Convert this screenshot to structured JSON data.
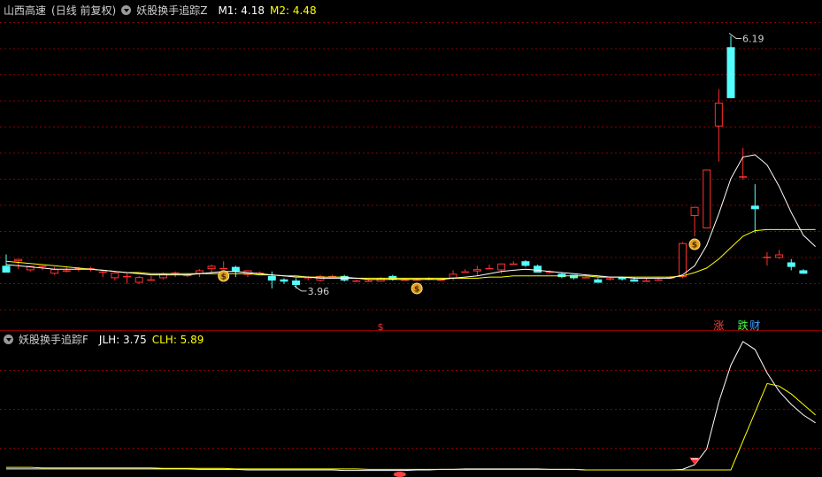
{
  "header_main": {
    "stock": "山西高速",
    "period": "(日线 前复权)",
    "indicator": "妖股换手追踪Z",
    "m1": "M1: 4.18",
    "m2": "M2: 4.48"
  },
  "header_sub": {
    "indicator": "妖股换手追踪F",
    "jlh": "JLH: 3.75",
    "clh": "CLH: 5.89"
  },
  "colors": {
    "background": "#000000",
    "grid": "#8b0000",
    "up": "#ff3030",
    "down": "#54ffff",
    "m1": "#ffffff",
    "m2": "#ffff00",
    "label": "#d0d0d0"
  },
  "chart_data": [
    {
      "type": "candlestick",
      "ylim": [
        3.6,
        6.35
      ],
      "candles": [
        [
          4.16,
          4.1,
          4.26,
          4.1
        ],
        [
          4.2,
          4.22,
          4.13,
          4.22
        ],
        [
          4.12,
          4.16,
          4.11,
          4.16
        ],
        [
          4.16,
          4.16,
          4.12,
          4.16
        ],
        [
          4.09,
          4.13,
          4.08,
          4.15
        ],
        [
          4.12,
          4.12,
          4.1,
          4.15
        ],
        [
          4.14,
          4.14,
          4.11,
          4.15
        ],
        [
          4.14,
          4.14,
          4.11,
          4.15
        ],
        [
          4.11,
          4.11,
          4.06,
          4.12
        ],
        [
          4.05,
          4.1,
          4.03,
          4.1
        ],
        [
          4.06,
          4.07,
          4.0,
          4.1
        ],
        [
          4.01,
          4.06,
          4.0,
          4.07
        ],
        [
          4.04,
          4.04,
          4.04,
          4.07
        ],
        [
          4.05,
          4.09,
          4.04,
          4.1
        ],
        [
          4.1,
          4.1,
          4.06,
          4.11
        ],
        [
          4.07,
          4.08,
          4.06,
          4.09
        ],
        [
          4.09,
          4.12,
          4.06,
          4.13
        ],
        [
          4.13,
          4.16,
          4.09,
          4.17
        ],
        [
          4.14,
          4.14,
          4.14,
          4.2
        ],
        [
          4.15,
          4.11,
          4.06,
          4.16
        ],
        [
          4.08,
          4.12,
          4.06,
          4.12
        ],
        [
          4.1,
          4.1,
          4.09,
          4.11
        ],
        [
          4.07,
          4.03,
          3.96,
          4.11
        ],
        [
          4.04,
          4.02,
          4.0,
          4.05
        ],
        [
          4.03,
          3.99,
          3.96,
          4.05
        ],
        [
          4.06,
          4.06,
          4.03,
          4.07
        ],
        [
          4.03,
          4.07,
          4.02,
          4.08
        ],
        [
          4.07,
          4.07,
          4.06,
          4.08
        ],
        [
          4.07,
          4.03,
          4.02,
          4.08
        ],
        [
          4.03,
          4.03,
          4.02,
          4.04
        ],
        [
          4.03,
          4.03,
          4.02,
          4.04
        ],
        [
          4.02,
          4.05,
          4.02,
          4.06
        ],
        [
          4.07,
          4.04,
          4.03,
          4.08
        ],
        [
          4.04,
          4.04,
          4.03,
          4.05
        ],
        [
          4.04,
          4.04,
          4.03,
          4.05
        ],
        [
          4.05,
          4.05,
          4.03,
          4.06
        ],
        [
          4.04,
          4.04,
          4.04,
          4.05
        ],
        [
          4.05,
          4.09,
          4.03,
          4.12
        ],
        [
          4.11,
          4.11,
          4.11,
          4.13
        ],
        [
          4.11,
          4.13,
          4.07,
          4.16
        ],
        [
          4.14,
          4.14,
          4.13,
          4.17
        ],
        [
          4.12,
          4.18,
          4.09,
          4.18
        ],
        [
          4.18,
          4.18,
          4.18,
          4.2
        ],
        [
          4.2,
          4.16,
          4.15,
          4.21
        ],
        [
          4.16,
          4.1,
          4.1,
          4.17
        ],
        [
          4.1,
          4.11,
          4.09,
          4.12
        ],
        [
          4.09,
          4.06,
          4.05,
          4.1
        ],
        [
          4.08,
          4.05,
          4.04,
          4.08
        ],
        [
          4.06,
          4.06,
          4.06,
          4.07
        ],
        [
          4.04,
          4.01,
          4.01,
          4.05
        ],
        [
          4.05,
          4.05,
          4.03,
          4.06
        ],
        [
          4.06,
          4.04,
          4.03,
          4.06
        ],
        [
          4.04,
          4.02,
          4.02,
          4.06
        ],
        [
          4.03,
          4.03,
          4.02,
          4.05
        ],
        [
          4.04,
          4.04,
          4.03,
          4.06
        ],
        [
          4.06,
          4.06,
          4.06,
          4.07
        ],
        [
          4.06,
          4.36,
          4.05,
          4.37
        ],
        [
          4.6,
          4.68,
          4.42,
          4.68
        ],
        [
          4.49,
          5.01,
          4.49,
          5.01
        ],
        [
          5.39,
          5.6,
          5.08,
          5.72
        ],
        [
          6.09,
          5.64,
          5.64,
          6.19
        ],
        [
          4.95,
          4.95,
          4.92,
          5.2
        ],
        [
          4.69,
          4.66,
          4.45,
          4.88
        ],
        [
          4.24,
          4.24,
          4.16,
          4.28
        ],
        [
          4.23,
          4.26,
          4.22,
          4.3
        ],
        [
          4.19,
          4.15,
          4.12,
          4.22
        ],
        [
          4.12,
          4.09,
          4.09,
          4.13
        ]
      ],
      "m1": [
        4.17,
        4.16,
        4.15,
        4.14,
        4.13,
        4.13,
        4.13,
        4.13,
        4.12,
        4.11,
        4.1,
        4.09,
        4.08,
        4.08,
        4.08,
        4.08,
        4.09,
        4.1,
        4.11,
        4.11,
        4.1,
        4.09,
        4.08,
        4.07,
        4.06,
        4.06,
        4.05,
        4.05,
        4.05,
        4.05,
        4.04,
        4.04,
        4.04,
        4.04,
        4.04,
        4.04,
        4.04,
        4.05,
        4.06,
        4.07,
        4.09,
        4.11,
        4.12,
        4.13,
        4.12,
        4.11,
        4.1,
        4.09,
        4.08,
        4.07,
        4.06,
        4.06,
        4.05,
        4.05,
        4.05,
        4.05,
        4.08,
        4.16,
        4.34,
        4.62,
        4.93,
        5.12,
        5.14,
        5.05,
        4.86,
        4.63,
        4.43,
        4.33
      ],
      "m2": [
        4.2,
        4.19,
        4.18,
        4.17,
        4.16,
        4.15,
        4.14,
        4.13,
        4.12,
        4.11,
        4.1,
        4.1,
        4.09,
        4.09,
        4.09,
        4.09,
        4.09,
        4.09,
        4.09,
        4.09,
        4.09,
        4.08,
        4.08,
        4.07,
        4.07,
        4.06,
        4.06,
        4.06,
        4.06,
        4.05,
        4.05,
        4.05,
        4.05,
        4.05,
        4.05,
        4.05,
        4.05,
        4.05,
        4.05,
        4.05,
        4.06,
        4.06,
        4.07,
        4.07,
        4.07,
        4.07,
        4.07,
        4.07,
        4.07,
        4.06,
        4.06,
        4.06,
        4.06,
        4.06,
        4.06,
        4.06,
        4.07,
        4.1,
        4.14,
        4.22,
        4.32,
        4.42,
        4.47,
        4.48,
        4.48,
        4.48,
        4.48,
        4.48
      ],
      "price_labels": [
        {
          "candle": 60,
          "value": 6.19,
          "text": "6.19"
        },
        {
          "candle": 24,
          "value": 3.96,
          "text": "3.96"
        }
      ],
      "markers": [
        {
          "candle": 18,
          "kind": "money-bag",
          "text": "$"
        },
        {
          "candle": 34,
          "kind": "money-bag",
          "text": "$"
        },
        {
          "candle": 57,
          "kind": "money-bag",
          "text": "$"
        },
        {
          "candle": 31,
          "kind": "axis-mark",
          "text": "$"
        }
      ],
      "tags": [
        {
          "candle": 59,
          "text": "涨",
          "color": "#ff4040"
        },
        {
          "candle": 61,
          "text": "跌",
          "color": "#40ff40"
        },
        {
          "candle": 62,
          "text": "财",
          "color": "#40a0ff"
        }
      ]
    },
    {
      "type": "line",
      "ylim": [
        0,
        25
      ],
      "series": [
        {
          "name": "JLH",
          "color": "#ffffff",
          "values": [
            0.7,
            0.7,
            0.7,
            0.7,
            0.7,
            0.7,
            0.7,
            0.7,
            0.7,
            0.7,
            0.7,
            0.7,
            0.7,
            0.7,
            0.7,
            0.7,
            0.6,
            0.6,
            0.6,
            0.6,
            0.5,
            0.5,
            0.5,
            0.5,
            0.5,
            0.5,
            0.5,
            0.5,
            0.4,
            0.4,
            0.4,
            0.4,
            0.4,
            0.4,
            0.5,
            0.5,
            0.6,
            0.6,
            0.7,
            0.7,
            0.7,
            0.7,
            0.7,
            0.7,
            0.7,
            0.6,
            0.6,
            0.6,
            0.5,
            0.5,
            0.5,
            0.5,
            0.5,
            0.5,
            0.5,
            0.5,
            0.6,
            1.5,
            4.5,
            13.5,
            20.5,
            25.0,
            23.5,
            19.0,
            15.5,
            13.0,
            11.0,
            9.5
          ]
        },
        {
          "name": "CLH",
          "color": "#ffff00",
          "values": [
            1.0,
            1.0,
            1.0,
            0.9,
            0.9,
            0.9,
            0.9,
            0.9,
            0.9,
            0.9,
            0.9,
            0.9,
            0.9,
            0.8,
            0.8,
            0.8,
            0.8,
            0.8,
            0.8,
            0.7,
            0.7,
            0.7,
            0.7,
            0.7,
            0.7,
            0.7,
            0.7,
            0.7,
            0.7,
            0.7,
            0.6,
            0.6,
            0.6,
            0.6,
            0.6,
            0.6,
            0.6,
            0.6,
            0.6,
            0.6,
            0.6,
            0.6,
            0.6,
            0.6,
            0.6,
            0.6,
            0.6,
            0.6,
            0.5,
            0.5,
            0.5,
            0.5,
            0.5,
            0.5,
            0.5,
            0.5,
            0.5,
            0.5,
            0.5,
            0.5,
            0.5,
            6.0,
            11.5,
            17.0,
            16.5,
            15.0,
            13.0,
            11.0
          ]
        }
      ],
      "markers": [
        {
          "candle": 57,
          "kind": "red-diamond"
        },
        {
          "candle": 32,
          "kind": "axis-mark-red"
        }
      ]
    }
  ]
}
